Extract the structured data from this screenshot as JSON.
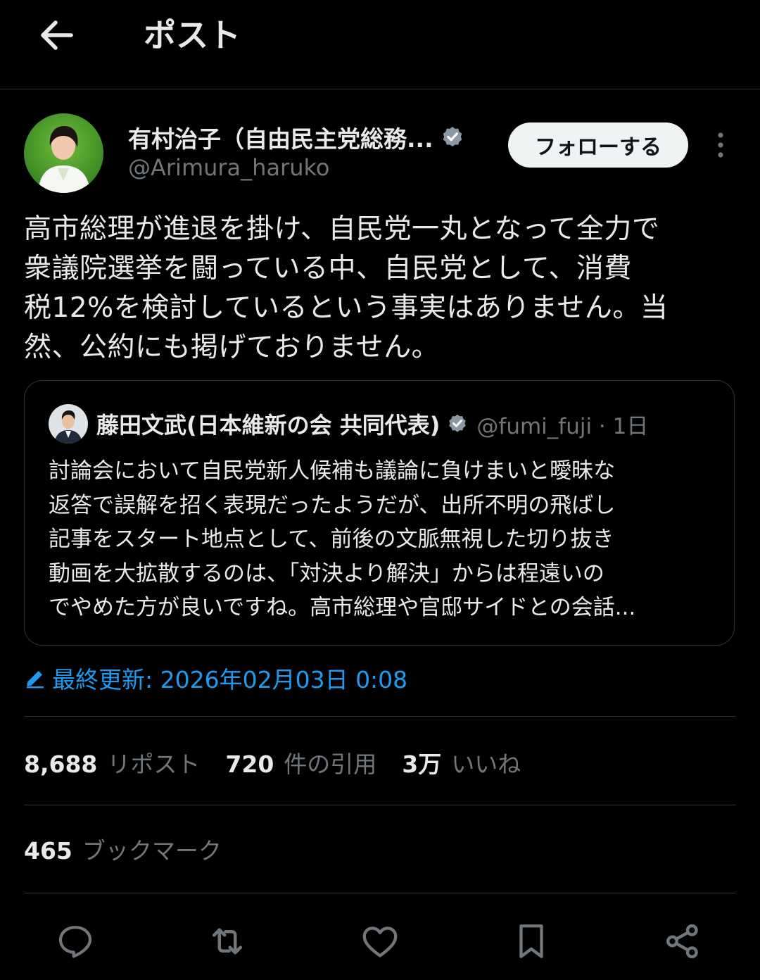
{
  "header": {
    "title": "ポスト"
  },
  "author": {
    "name": "有村治子（自由民主党総務...",
    "handle": "@Arimura_haruko",
    "follow_label": "フォローする"
  },
  "post": {
    "lines": [
      "高市総理が進退を掛け、自民党一丸となって全力で",
      "衆議院選挙を闘っている中、自民党として、消費",
      "税12%を検討しているという事実はありません。当",
      "然、公約にも掲げておりません。"
    ]
  },
  "quote": {
    "name": "藤田文武(日本維新の会 共同代表)",
    "meta": "@fumi_fuji · 1日",
    "lines": [
      "討論会において自民党新人候補も議論に負けまいと曖昧な",
      "返答で誤解を招く表現だったようだが、出所不明の飛ばし",
      "記事をスタート地点として、前後の文脈無視した切り抜き",
      "動画を大拡散するのは、「対決より解決」からは程遠いの",
      "でやめた方が良いですね。高市総理や官邸サイドとの会話..."
    ]
  },
  "edited": {
    "text": "最終更新: 2026年02月03日 0:08"
  },
  "stats": {
    "reposts": {
      "num": "8,688",
      "label": "リポスト"
    },
    "quotes": {
      "num": "720",
      "label": "件の引用"
    },
    "likes": {
      "num": "3万",
      "label": "いいね"
    },
    "bookmarks": {
      "num": "465",
      "label": "ブックマーク"
    }
  },
  "actions": [
    "reply-icon",
    "repost-icon",
    "like-icon",
    "bookmark-icon",
    "share-icon"
  ],
  "colors": {
    "background": "#000000",
    "accent": "#1d9bf0",
    "muted": "#71767b",
    "divider": "#2f3336"
  }
}
